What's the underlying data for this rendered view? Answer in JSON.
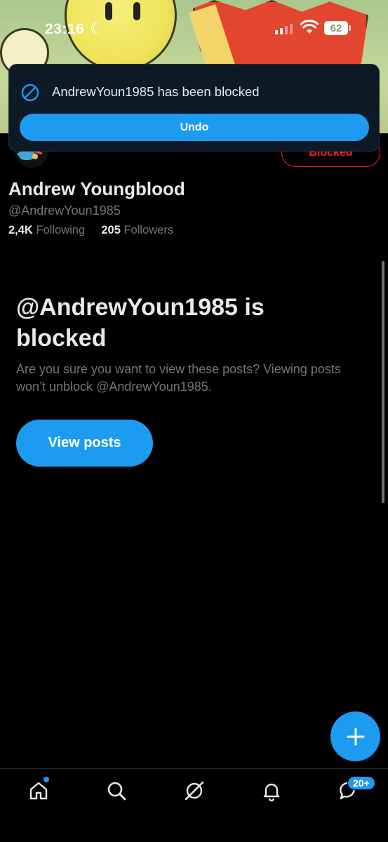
{
  "status_bar": {
    "time": "23:16",
    "battery": "62"
  },
  "toast": {
    "message": "AndrewYoun1985 has been blocked",
    "undo_label": "Undo"
  },
  "profile": {
    "name": "Andrew Youngblood",
    "handle": "@AndrewYoun1985",
    "following_count": "2,4K",
    "following_label": "Following",
    "followers_count": "205",
    "followers_label": "Followers",
    "blocked_button": "Blocked"
  },
  "blocked_notice": {
    "title": "@AndrewYoun1985 is blocked",
    "description": "Are you sure you want to view these posts? Viewing posts won’t unblock @AndrewYoun1985.",
    "view_posts_label": "View posts"
  },
  "nav": {
    "items": [
      "home-icon",
      "search-icon",
      "grok-icon",
      "bell-icon",
      "messages-icon"
    ],
    "messages_badge": "20+"
  },
  "colors": {
    "accent": "#1d9bf0",
    "danger": "#f4212e",
    "muted": "#71767b",
    "text": "#e7e9ea"
  }
}
